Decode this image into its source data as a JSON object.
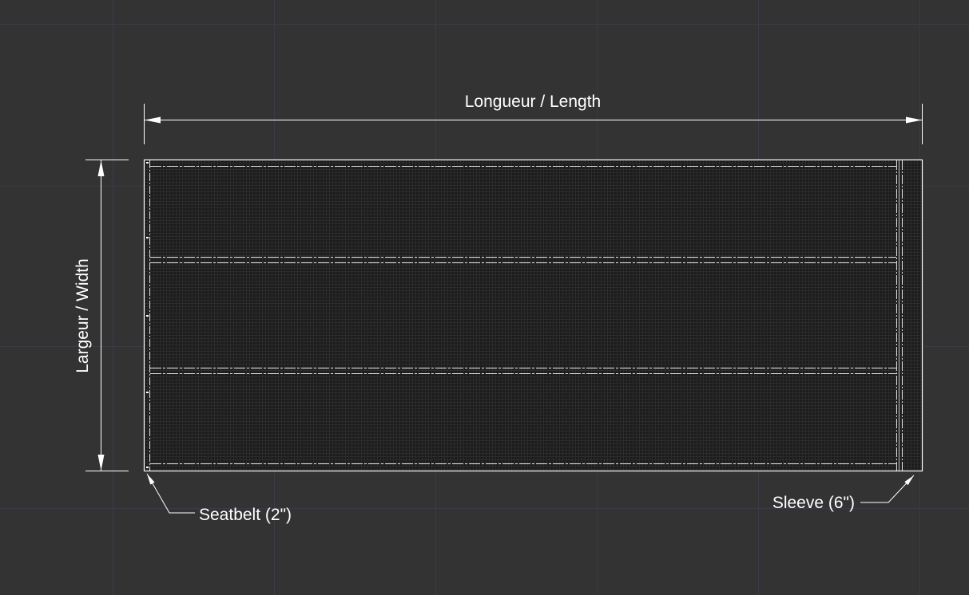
{
  "colors": {
    "background": "#333333",
    "grid": "#3d3d50",
    "line": "#ffffff",
    "mesh": "#1a1a1a"
  },
  "drawing": {
    "length_label": "Longueur / Length",
    "width_label": "Largeur / Width",
    "seatbelt_label": "Seatbelt (2\")",
    "sleeve_label": "Sleeve (6\")"
  }
}
